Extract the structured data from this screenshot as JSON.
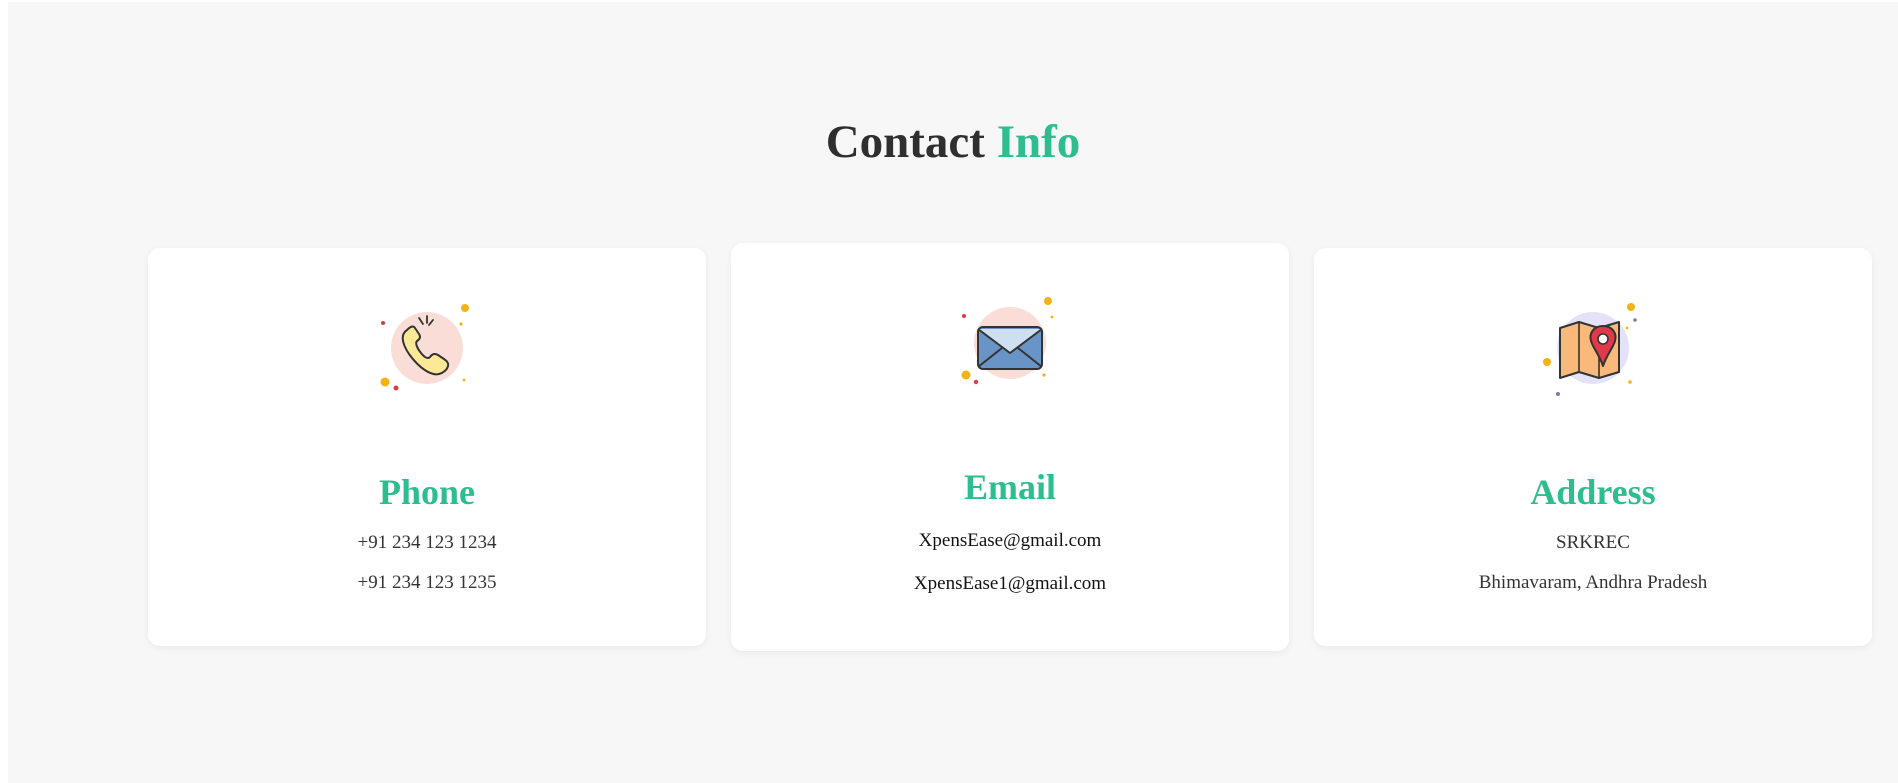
{
  "heading": {
    "part1": "Contact",
    "part2": "Info"
  },
  "colors": {
    "accent": "#2ebd8f",
    "heading_text": "#2f2f2f",
    "section_bg": "#f7f7f7",
    "card_bg": "#ffffff"
  },
  "cards": [
    {
      "icon": "phone-icon",
      "title": "Phone",
      "lines": [
        "+91 234 123 1234",
        "+91 234 123 1235"
      ]
    },
    {
      "icon": "email-icon",
      "title": "Email",
      "lines": [
        "XpensEase@gmail.com",
        "XpensEase1@gmail.com"
      ]
    },
    {
      "icon": "map-pin-icon",
      "title": "Address",
      "lines": [
        "SRKREC",
        "Bhimavaram, Andhra Pradesh"
      ]
    }
  ]
}
